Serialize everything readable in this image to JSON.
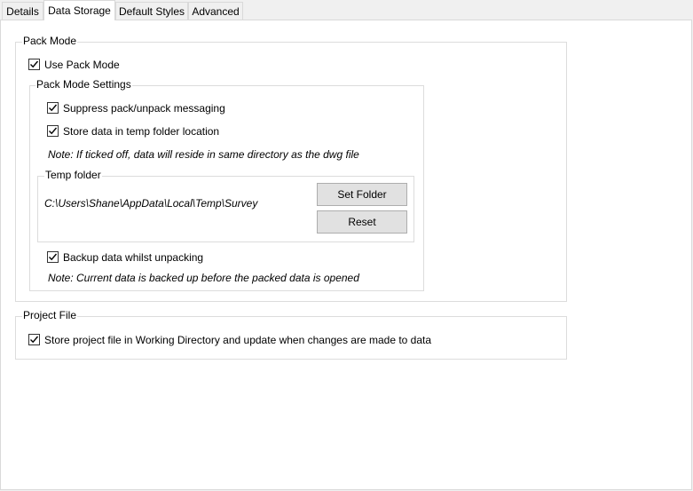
{
  "tabs": [
    {
      "label": "Details"
    },
    {
      "label": "Data Storage"
    },
    {
      "label": "Default Styles"
    },
    {
      "label": "Advanced"
    }
  ],
  "active_tab": "Data Storage",
  "pack_mode": {
    "title": "Pack Mode",
    "use_pack_mode": {
      "label": "Use Pack Mode",
      "checked": true
    },
    "settings": {
      "title": "Pack Mode Settings",
      "suppress": {
        "label": "Suppress pack/unpack messaging",
        "checked": true
      },
      "store_temp": {
        "label": "Store data in temp folder location",
        "checked": true
      },
      "note_temp": "Note: If ticked off, data will reside in same directory as the dwg file",
      "temp_folder": {
        "title": "Temp folder",
        "path": "C:\\Users\\Shane\\AppData\\Local\\Temp\\Survey",
        "set_folder_label": "Set Folder",
        "reset_label": "Reset"
      },
      "backup": {
        "label": "Backup data whilst unpacking",
        "checked": true
      },
      "note_backup": "Note: Current data is backed up before the packed data is opened"
    }
  },
  "project_file": {
    "title": "Project File",
    "store_project": {
      "label": "Store project file in Working Directory and update when changes are made to data",
      "checked": true
    }
  }
}
